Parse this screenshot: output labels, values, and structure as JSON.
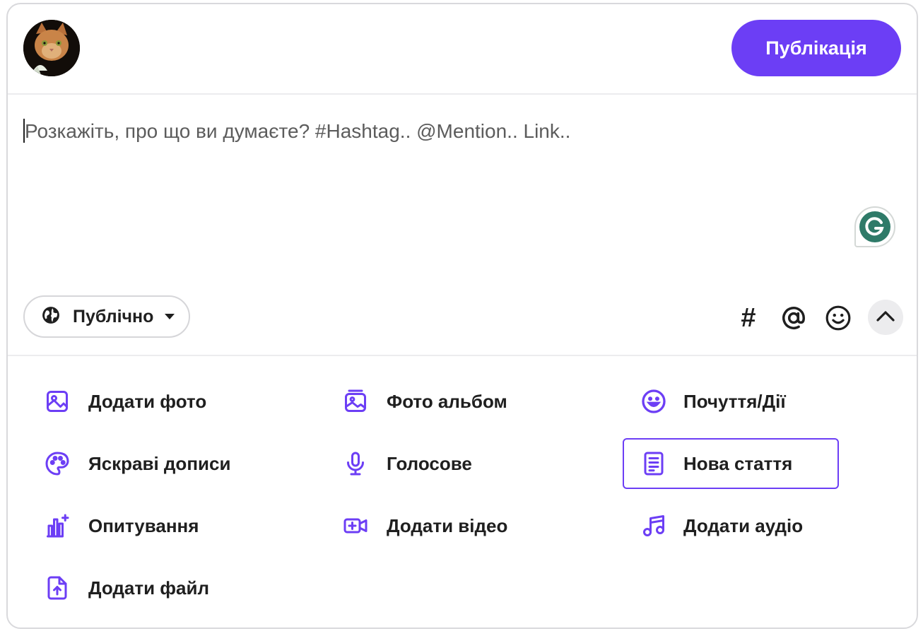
{
  "header": {
    "publish_label": "Публікація"
  },
  "composer": {
    "placeholder": "Розкажіть, про що ви думаєте? #Hashtag.. @Mention.. Link.."
  },
  "privacy": {
    "label": "Публічно",
    "icon": "globe-icon"
  },
  "toolbar": {
    "hashtag_symbol": "#",
    "icons": [
      "hashtag-icon",
      "mention-icon",
      "emoji-icon",
      "chevron-up-icon"
    ]
  },
  "options": [
    {
      "label": "Додати фото",
      "icon": "image-icon"
    },
    {
      "label": "Фото альбом",
      "icon": "photo-album-icon"
    },
    {
      "label": "Почуття/Дії",
      "icon": "smile-icon"
    },
    {
      "label": "Яскраві дописи",
      "icon": "palette-icon"
    },
    {
      "label": "Голосове",
      "icon": "microphone-icon"
    },
    {
      "label": "Нова стаття",
      "icon": "article-icon",
      "selected": true
    },
    {
      "label": "Опитування",
      "icon": "poll-icon"
    },
    {
      "label": "Додати відео",
      "icon": "video-add-icon"
    },
    {
      "label": "Додати аудіо",
      "icon": "music-note-icon"
    },
    {
      "label": "Додати файл",
      "icon": "file-upload-icon"
    }
  ],
  "colors": {
    "accent": "#6c3ef5",
    "grammarly": "#2e7a68",
    "border": "#d9d9dc",
    "text": "#1f1f1f"
  }
}
